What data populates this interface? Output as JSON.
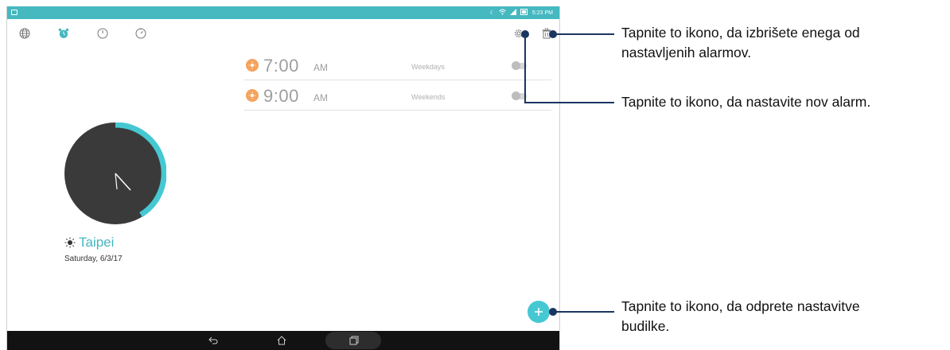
{
  "status_bar": {
    "time": "5:23 PM",
    "icons": [
      "notification-icon",
      "moon-icon",
      "wifi-icon",
      "signal-icon",
      "battery-icon"
    ]
  },
  "toolbar": {
    "tabs": [
      "world-clock-icon",
      "alarm-icon",
      "stopwatch-icon",
      "timer-icon"
    ],
    "active_tab": "alarm-icon",
    "actions": [
      "settings-icon",
      "delete-icon"
    ]
  },
  "alarms": [
    {
      "time": "7:00",
      "ampm": "AM",
      "repeat": "Weekdays",
      "enabled": false
    },
    {
      "time": "9:00",
      "ampm": "AM",
      "repeat": "Weekends",
      "enabled": false
    }
  ],
  "world_clock": {
    "city": "Taipei",
    "date": "Saturday, 6/3/17"
  },
  "callouts": {
    "delete": "Tapnite to ikono, da izbrišete enega od nastavljenih alarmov.",
    "delete_line1": "Tapnite to ikono, da izbrišete enega od",
    "delete_line2": "nastavljenih alarmov.",
    "settings": "Tapnite to ikono, da nastavite nov alarm.",
    "add_line1": "Tapnite to ikono, da odprete nastavitve",
    "add_line2": "budilke."
  },
  "colors": {
    "accent": "#45b8c0",
    "fab": "#45c8d2",
    "alarm_sun": "#f4a35e",
    "clock_face": "#3a3a3a",
    "callout": "#1a3560"
  }
}
